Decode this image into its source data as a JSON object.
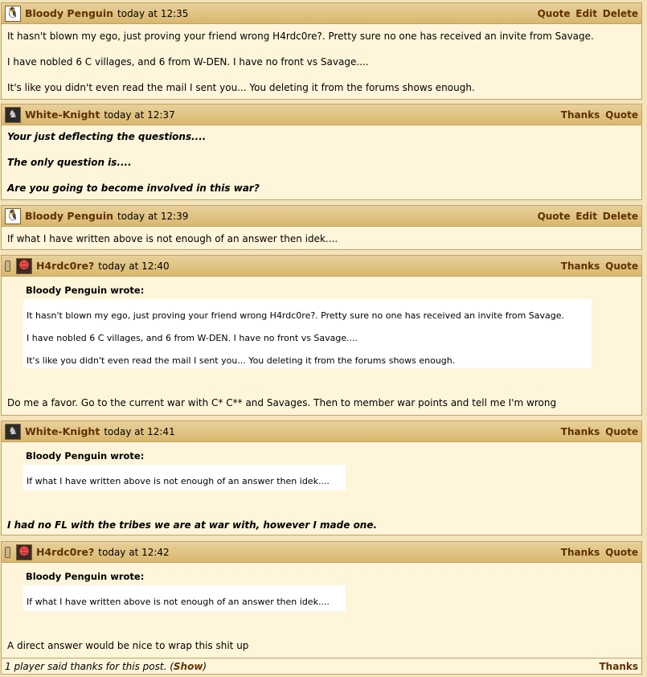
{
  "posts": [
    {
      "author": "Bloody Penguin",
      "time": "today at 12:35",
      "actions": [
        "Quote",
        "Edit",
        "Delete"
      ],
      "lines": [
        "It hasn't blown my ego, just proving your friend wrong H4rdc0re?. Pretty sure no one has received an invite from Savage.",
        "I have nobled 6 C villages, and 6 from W-DEN. I have no front vs Savage....",
        "It's like you didn't even read the mail I sent you... You deleting it from the forums shows enough."
      ]
    },
    {
      "author": "White-Knight",
      "time": "today at 12:37",
      "actions": [
        "Thanks",
        "Quote"
      ],
      "lines": [
        "Your just deflecting the questions....",
        "The only question is....",
        "Are you going to become involved in this war?"
      ]
    },
    {
      "author": "Bloody Penguin",
      "time": "today at 12:39",
      "actions": [
        "Quote",
        "Edit",
        "Delete"
      ],
      "lines": [
        "If what I have written above is not enough of an answer then idek...."
      ]
    },
    {
      "author": "H4rdc0re?",
      "time": "today at 12:40",
      "actions": [
        "Thanks",
        "Quote"
      ],
      "quote_title": "Bloody Penguin wrote:",
      "quote_lines": [
        "It hasn't blown my ego, just proving your friend wrong H4rdc0re?. Pretty sure no one has received an invite from Savage.",
        "I have nobled 6 C villages, and 6 from W-DEN. I have no front vs Savage....",
        "It's like you didn't even read the mail I sent you... You deleting it from the forums shows enough."
      ],
      "lines": [
        "Do me a favor. Go to the current war with C* C** and Savages. Then to member war points and tell me I'm wrong"
      ]
    },
    {
      "author": "White-Knight",
      "time": "today at 12:41",
      "actions": [
        "Thanks",
        "Quote"
      ],
      "quote_title": "Bloody Penguin wrote:",
      "quote_lines": [
        "If what I have written above is not enough of an answer then idek...."
      ],
      "lines": [
        "I had no FL with the tribes we are at war with, however I made one."
      ]
    },
    {
      "author": "H4rdc0re?",
      "time": "today at 12:42",
      "actions": [
        "Thanks",
        "Quote"
      ],
      "quote_title": "Bloody Penguin wrote:",
      "quote_lines": [
        "If what I have written above is not enough of an answer then idek...."
      ],
      "lines": [
        "A direct answer would be nice to wrap this shit up"
      ],
      "footer": {
        "thanks_info_prefix": "1 player said thanks for this post. (",
        "show_label": "Show",
        "thanks_info_suffix": ")",
        "thanks_label": "Thanks"
      }
    }
  ]
}
